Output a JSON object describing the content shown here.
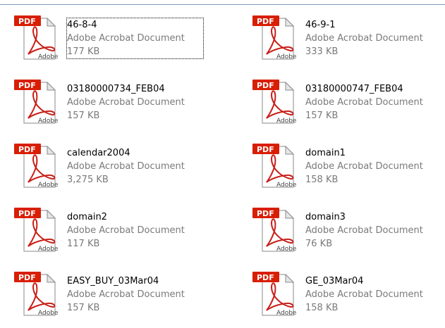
{
  "files": [
    {
      "name": "46-8-4",
      "type": "Adobe Acrobat Document",
      "size": "177 KB",
      "focused": true,
      "icon": "pdf-icon"
    },
    {
      "name": "46-9-1",
      "type": "Adobe Acrobat Document",
      "size": "333 KB",
      "focused": false,
      "icon": "pdf-icon"
    },
    {
      "name": "03180000734_FEB04",
      "type": "Adobe Acrobat Document",
      "size": "157 KB",
      "focused": false,
      "icon": "pdf-icon"
    },
    {
      "name": "03180000747_FEB04",
      "type": "Adobe Acrobat Document",
      "size": "157 KB",
      "focused": false,
      "icon": "pdf-icon"
    },
    {
      "name": "calendar2004",
      "type": "Adobe Acrobat Document",
      "size": "3,275 KB",
      "focused": false,
      "icon": "pdf-icon"
    },
    {
      "name": "domain1",
      "type": "Adobe Acrobat Document",
      "size": "158 KB",
      "focused": false,
      "icon": "pdf-icon"
    },
    {
      "name": "domain2",
      "type": "Adobe Acrobat Document",
      "size": "117 KB",
      "focused": false,
      "icon": "pdf-icon"
    },
    {
      "name": "domain3",
      "type": "Adobe Acrobat Document",
      "size": "76 KB",
      "focused": false,
      "icon": "pdf-icon"
    },
    {
      "name": "EASY_BUY_03Mar04",
      "type": "Adobe Acrobat Document",
      "size": "157 KB",
      "focused": false,
      "icon": "pdf-icon"
    },
    {
      "name": "GE_03Mar04",
      "type": "Adobe Acrobat Document",
      "size": "158 KB",
      "focused": false,
      "icon": "pdf-icon"
    }
  ],
  "icon_labels": {
    "badge": "PDF",
    "brand": "Adobe"
  },
  "colors": {
    "badge_red": "#d81e05",
    "accent_red": "#c8201a",
    "meta_gray": "#7a7a7a"
  }
}
